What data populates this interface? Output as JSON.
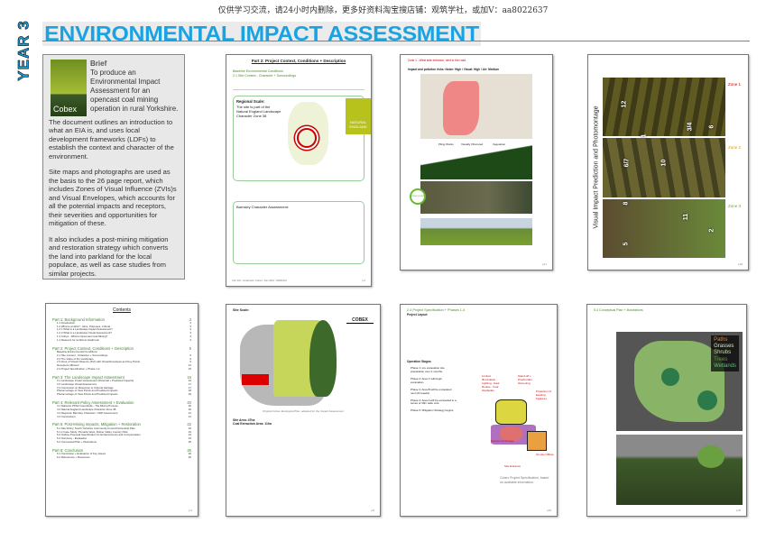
{
  "watermark": "仅供学习交流，请24小时内删除，更多好资料淘宝搜店铺：观筑学社，或加V：aa8022637",
  "year_label": "YEAR 3",
  "title": "ENVIRONMENTAL IMPACT ASSESSMENT",
  "colors": {
    "accent": "#1aa3e0",
    "green": "#4a8a2a"
  },
  "brief": {
    "cover_label": "Cobex",
    "heading": "Brief",
    "intro": "To produce an Environmental Impact Assessment for an opencast coal mining operation in rural Yorkshire.",
    "paragraphs": [
      "The document outlines an introduction to what an EIA is, and uses local development frameworks (LDFs) to establish the context and character of the environment.",
      "Site maps and photographs are used as the basis to the 26 page report, which includes Zones of Visual Influence (ZVIs)s and Visual Envelopes, which accounts for all the potential impacts and receptors, their severities and opportunities for mitigation of these.",
      "It also includes a post-mining mitigation and restoration strategy which converts the land into parkland for the local populace, as well as case studies from similar projects."
    ]
  },
  "p2": {
    "title": "Part 2: Project Context, Conditions + Description",
    "sub1": "Baseline Environmental Conditions",
    "sub2": "2.1 Site Context - Character + Surroundings",
    "regional": "Regional Scale:",
    "regional_text": "The site is part of the Natural England Landscape Character Zone 38",
    "logo": "NATURAL ENGLAND",
    "barnsley": "Barnsley Character Assessment:",
    "footer": "LSC 301 - Howbrook / Cobex / Dec 2010 - 80601601",
    "page": "p.6"
  },
  "p3": {
    "zone": "Zone 1 - West side entrance, next to the road.",
    "risks": "Impact and pollution risks: Noise: High / Visual: High / Air: Medium",
    "labels": [
      "Piling Works",
      "Visually Obscured",
      "Vegetation"
    ],
    "view": "View point",
    "page": "p.17"
  },
  "p4": {
    "title": "Visual Impact Prediction and Photomontage",
    "zones": [
      "Zone 1",
      "Zone 2",
      "Zone 3"
    ],
    "numbers": [
      "5",
      "8",
      "6/7",
      "1",
      "12",
      "11",
      "10",
      "3/4",
      "2",
      "6"
    ],
    "page": "p.18"
  },
  "contents": {
    "title": "Contents",
    "parts": [
      {
        "label": "Part 1: Background Information",
        "page": "3",
        "items": [
          [
            "1.1 Introduction",
            "3"
          ],
          [
            "1.2 What is an EIA? - Aims, Purposes, Criteria",
            "3"
          ],
          [
            "1.2.1 What is a Landscape Impact Assessment?",
            "3"
          ],
          [
            "1.2.2 What is a Landscape Visual Assessment?",
            "3"
          ],
          [
            "1.3 Cobex - What is Opencast Coal Mining?",
            "4"
          ],
          [
            "1.4 Reasons for an EIA at Howbrook",
            "4"
          ]
        ]
      },
      {
        "label": "Part 2: Project Context, Conditions + Description",
        "page": "5",
        "items": [
          [
            "Baseline Environmental Conditions",
            ""
          ],
          [
            "2.1 Site Context - Character + Surroundings",
            "5"
          ],
          [
            "2.2 The Value of the Landscape",
            "9"
          ],
          [
            "2.3 Zone of Visual Influence (ZVI) with Visual Envelopes and Key Points",
            "9"
          ],
          [
            "Receptors Affected",
            "14"
          ],
          [
            "2.4 Project Specification + Phase 1-4",
            "15"
          ]
        ]
      },
      {
        "label": "Part 3: The Landscape Impact Assessment",
        "page": "16",
        "items": [
          [
            "3.1 Landscape Impact Assessment (Potential + Predicted Impacts)",
            "16"
          ],
          [
            "3.2 Landscape Visual Assessment",
            "17"
          ],
          [
            "3.3 Conclusion on Response to Cultural Heritage",
            "17"
          ],
          [
            "Photomontage of View Points and Predicted Impacts",
            "18"
          ],
          [
            "Photomontage of View Points and Predicted Impacts",
            "19"
          ]
        ]
      },
      {
        "label": "Part 4: Relevant Policy Assessment + Evaluation",
        "page": "20",
        "items": [
          [
            "4.1 National: PPG2 Greenbelts - The Mining Process",
            "20"
          ],
          [
            "4.2 Natural England Landscape Character Zone 38",
            "20"
          ],
          [
            "4.3 Regional: Barnsley Character / UDP Assessment",
            "21"
          ],
          [
            "4.4 Conclusions",
            "21"
          ]
        ]
      },
      {
        "label": "Part 5: Post-Mining Impacts, Mitigation + Restoration",
        "page": "22",
        "items": [
          [
            "5.1 Site Policy: South Yorkshire Community Forest Partnership Plan",
            "22"
          ],
          [
            "5.1.2 Case Study: Pinnacle West, Rother Valley Country Park",
            "23"
          ],
          [
            "5.2 Outline Proposal Specification for Enhancements and Compensation",
            "24"
          ],
          [
            "5.3 Summary - Evaluation",
            "24"
          ],
          [
            "5.4 Conceptual Plan + Illustrations",
            "25"
          ]
        ]
      },
      {
        "label": "Part 6: Conclusion",
        "page": "26",
        "items": [
          [
            "6.1 Conclusion + Evaluation of Key Issues",
            "26"
          ],
          [
            "6.2 References + Resources",
            "26"
          ]
        ]
      }
    ],
    "page": "p.2"
  },
  "p6": {
    "title": "Site Scale:",
    "caption": "Original Cobex Ecological Plan, adapted for the Impact Assessment",
    "area": "Site Area: 47ha",
    "coal": "Coal Extraction Area: 11ha",
    "logo": "COBEX",
    "page": "p.8"
  },
  "p7": {
    "title": "2.4 Project Specification + Phases 1-4",
    "layout": "Project Layout:",
    "stages": "Operation Stages:",
    "phases": [
      "Phase 1: pre excavation site preparation over 2 months.",
      "Phase 2: Area C will begin excavation.",
      "Phase 3: Area B will be excavated next (24 weeks)",
      "Phase 4: Area A will be excavated in a series of 40m wide cuts.",
      "Phase 5: Mitigation Strategy begins."
    ],
    "callouts": [
      "Limited Illumination - Lighting - Haul Routes - Coal Stockpiles",
      "Stand-off + Overburden Screening",
      "Protection of Existing Features",
      "Equipment Storage",
      "On-site Offices",
      "Site Entrance"
    ],
    "caption": "Cobex Project Specification, based on available information.",
    "page": "p.15"
  },
  "p8": {
    "title": "5.4 Conceptual Plan + Illustrations",
    "legend": [
      "Paths",
      "Grasses",
      "Shrubs",
      "Trees",
      "Wetlands"
    ],
    "page": "p.25"
  }
}
